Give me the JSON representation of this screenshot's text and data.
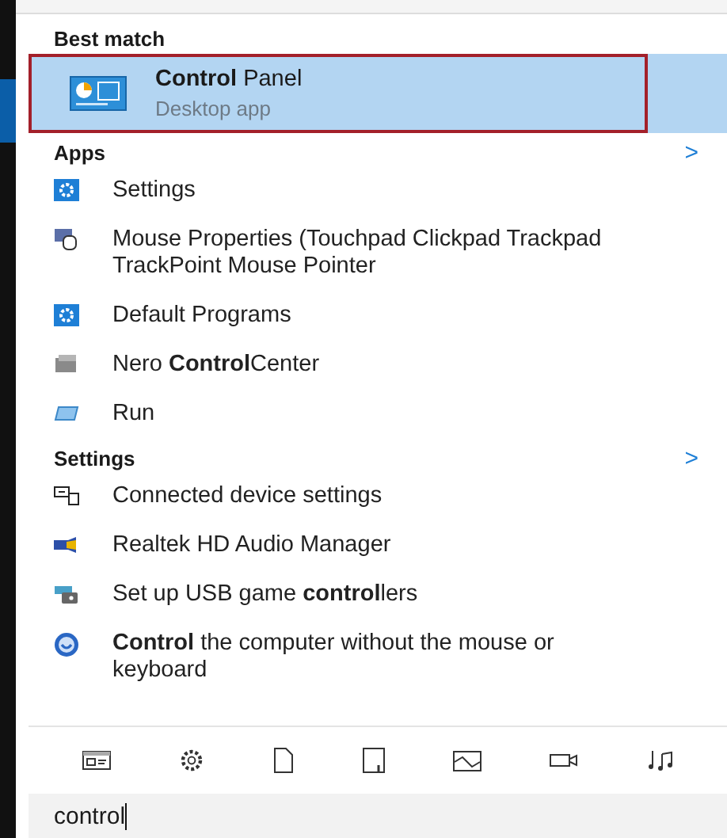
{
  "best_match": {
    "heading": "Best match",
    "item": {
      "title": "**Control** Panel",
      "subtitle": "Desktop app",
      "selected": true
    }
  },
  "sections": [
    {
      "heading": "Apps",
      "more": ">",
      "items": [
        {
          "title": "Settings"
        },
        {
          "title": "Mouse Properties (Touchpad Clickpad Trackpad TrackPoint Mouse Pointer"
        },
        {
          "title": "Default Programs"
        },
        {
          "title": "Nero **Control**Center"
        },
        {
          "title": "Run"
        }
      ]
    },
    {
      "heading": "Settings",
      "more": ">",
      "items": [
        {
          "title": "Connected device settings"
        },
        {
          "title": "Realtek HD Audio Manager"
        },
        {
          "title": "Set up USB game **control**lers"
        },
        {
          "title": "**Control** the computer without the mouse or keyboard"
        }
      ]
    }
  ],
  "search": {
    "value": "control"
  }
}
